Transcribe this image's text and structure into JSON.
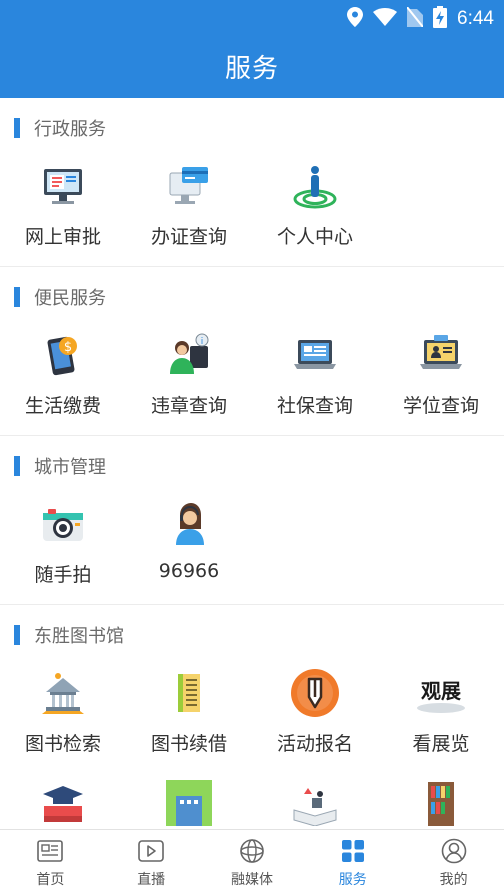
{
  "status_bar": {
    "time": "6:44"
  },
  "app_bar": {
    "title": "服务"
  },
  "sections": [
    {
      "title": "行政服务",
      "items": [
        {
          "label": "网上审批",
          "icon": "computer-approval-icon"
        },
        {
          "label": "办证查询",
          "icon": "card-query-icon"
        },
        {
          "label": "个人中心",
          "icon": "person-target-icon"
        }
      ]
    },
    {
      "title": "便民服务",
      "items": [
        {
          "label": "生活缴费",
          "icon": "phone-payment-icon"
        },
        {
          "label": "违章查询",
          "icon": "agent-info-icon"
        },
        {
          "label": "社保查询",
          "icon": "laptop-social-icon"
        },
        {
          "label": "学位查询",
          "icon": "laptop-degree-icon"
        }
      ]
    },
    {
      "title": "城市管理",
      "items": [
        {
          "label": "随手拍",
          "icon": "camera-icon"
        },
        {
          "label": "96966",
          "icon": "service-agent-icon"
        }
      ]
    },
    {
      "title": "东胜图书馆",
      "items": [
        {
          "label": "图书检索",
          "icon": "library-building-icon"
        },
        {
          "label": "图书续借",
          "icon": "book-stack-icon"
        },
        {
          "label": "活动报名",
          "icon": "pencil-circle-icon"
        },
        {
          "label": "看展览",
          "icon": "exhibition-icon"
        },
        {
          "label": "",
          "icon": "graduation-book-icon"
        },
        {
          "label": "",
          "icon": "green-building-icon"
        },
        {
          "label": "",
          "icon": "open-book-icon"
        },
        {
          "label": "",
          "icon": "bookshelf-icon"
        }
      ]
    }
  ],
  "bottom_nav": [
    {
      "label": "首页",
      "icon": "newspaper-icon"
    },
    {
      "label": "直播",
      "icon": "play-icon"
    },
    {
      "label": "融媒体",
      "icon": "globe-icon"
    },
    {
      "label": "服务",
      "icon": "grid-icon",
      "active": true
    },
    {
      "label": "我的",
      "icon": "user-icon"
    }
  ],
  "colors": {
    "primary": "#2a86dd",
    "text": "#333333",
    "muted": "#6a6a6a"
  }
}
